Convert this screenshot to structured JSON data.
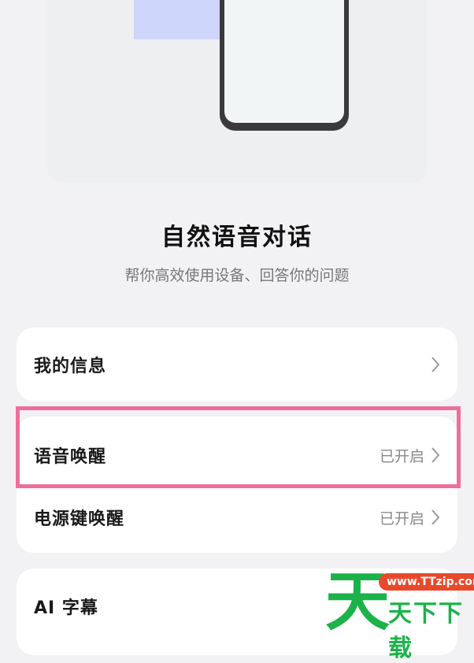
{
  "header": {
    "title": "自然语音对话",
    "subtitle": "帮你高效使用设备、回答你的问题"
  },
  "card1": {
    "my_info": {
      "label": "我的信息"
    }
  },
  "card2": {
    "voice_wakeup": {
      "label": "语音唤醒",
      "status": "已开启"
    },
    "power_key_wakeup": {
      "label": "电源键唤醒",
      "status": "已开启"
    }
  },
  "card3": {
    "ai_subtitles": {
      "label": "AI 字幕"
    }
  },
  "watermark": {
    "logo_char": "天",
    "url": "www.TTzip.com",
    "text": "天下下载"
  },
  "colors": {
    "highlight": "#ec6f9b",
    "watermark_green": "#1bb24a",
    "watermark_red": "#e8492b"
  }
}
